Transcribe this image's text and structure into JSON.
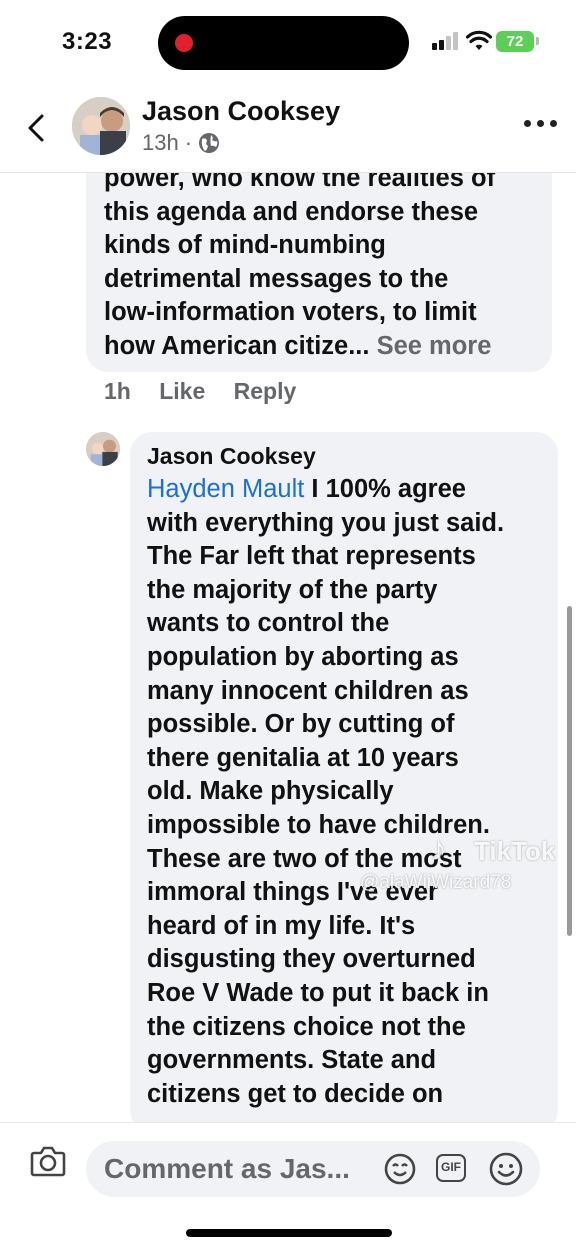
{
  "status_bar": {
    "time": "3:23",
    "battery": "72"
  },
  "header": {
    "name": "Jason Cooksey",
    "time_ago": "13h",
    "separator": "·"
  },
  "comment_one": {
    "lines": [
      "power, who know the realities of",
      "this agenda and endorse these",
      "kinds of mind-numbing",
      "detrimental messages to the",
      "low-information voters, to limit",
      "how American citize..."
    ],
    "see_more": "See more",
    "time_ago": "1h",
    "like": "Like",
    "reply": "Reply"
  },
  "comment_two": {
    "author": "Jason Cooksey",
    "mention": "Hayden Mault",
    "first_line_rest": " I 100% agree",
    "lines": [
      "with everything you just said.",
      "The Far left that represents",
      "the majority of the party",
      "wants to control the",
      "population by aborting as",
      "many innocent children as",
      "possible. Or by cutting of",
      "there genitalia at 10 years",
      "old. Make physically",
      "impossible to have children.",
      "These are two of the most",
      "immoral  things I've ever",
      "heard of in my life. It's",
      "disgusting they overturned",
      "Roe V Wade to put it back in",
      "the citizens choice not the",
      "governments. State and",
      "citizens get to decide on"
    ]
  },
  "watermark": {
    "label": "TikTok",
    "user": "@alaWiiWizard78"
  },
  "composer": {
    "placeholder": "Comment as Jas...",
    "gif_label": "GIF"
  }
}
